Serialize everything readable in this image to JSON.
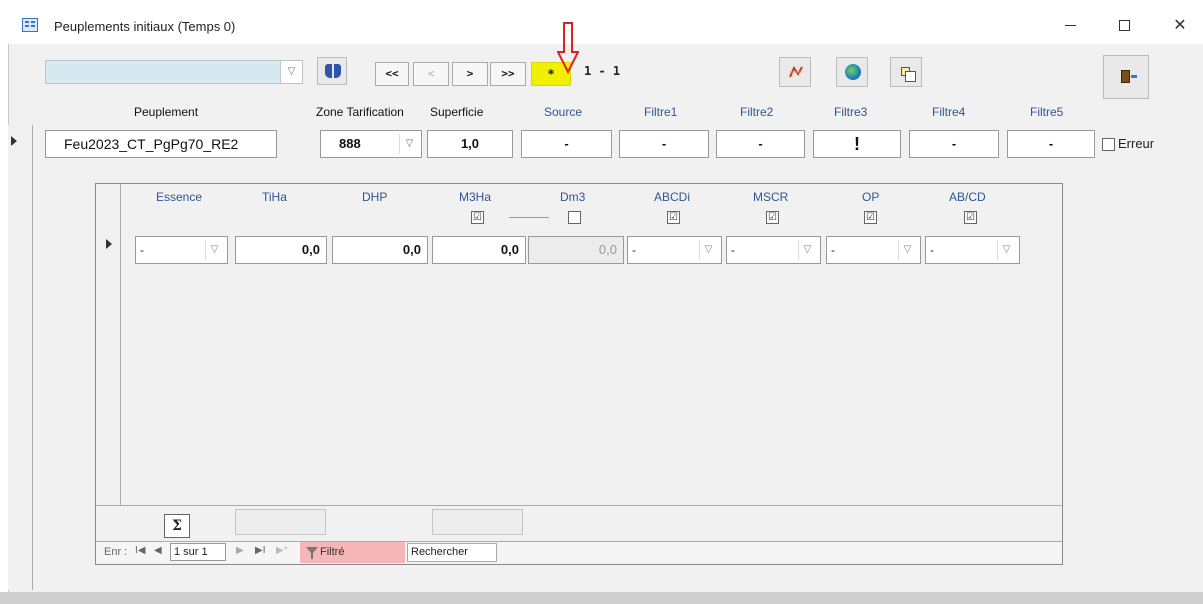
{
  "window": {
    "title": "Peuplements initiaux (Temps 0)",
    "minimize": "—",
    "maximize": "☐",
    "close": "✕"
  },
  "toolbar": {
    "search_combo_value": "",
    "nav_first": "<<",
    "nav_prev": "<",
    "nav_next": ">",
    "nav_last": ">>",
    "nav_new": "*",
    "record_counter": "1 - 1",
    "highlight_color": "#f0f000",
    "arrow_color": "#e02020"
  },
  "headers": {
    "peuplement": "Peuplement",
    "zone": "Zone Tarification",
    "superficie": "Superficie",
    "source": "Source",
    "filtre1": "Filtre1",
    "filtre2": "Filtre2",
    "filtre3": "Filtre3",
    "filtre4": "Filtre4",
    "filtre5": "Filtre5"
  },
  "record": {
    "peuplement": "Feu2023_CT_PgPg70_RE2",
    "zone": "888",
    "superficie": "1,0",
    "source": "-",
    "filtre1": "-",
    "filtre2": "-",
    "filtre3": "!",
    "filtre4": "-",
    "filtre5": "-",
    "erreur_label": "Erreur",
    "erreur_checked": false
  },
  "subform": {
    "columns": {
      "essence": "Essence",
      "tiha": "TiHa",
      "dhp": "DHP",
      "m3ha": "M3Ha",
      "dm3": "Dm3",
      "abcdi": "ABCDi",
      "mscr": "MSCR",
      "op": "OP",
      "abcd": "AB/CD"
    },
    "checks": {
      "m3ha": "☑",
      "dm3": "",
      "abcdi": "☑",
      "mscr": "☑",
      "op": "☑",
      "abcd": "☑"
    },
    "row": {
      "essence": "-",
      "tiha": "0,0",
      "dhp": "0,0",
      "m3ha": "0,0",
      "dm3": "0,0",
      "abcdi": "-",
      "mscr": "-",
      "op": "-",
      "abcd": "-"
    },
    "sigma": "Σ"
  },
  "navbar": {
    "label": "Enr :",
    "first": "I◀",
    "prev": "◀",
    "position": "1 sur 1",
    "next": "▶",
    "last": "▶I",
    "new": "▶*",
    "filter": "Filtré",
    "search": "Rechercher"
  }
}
